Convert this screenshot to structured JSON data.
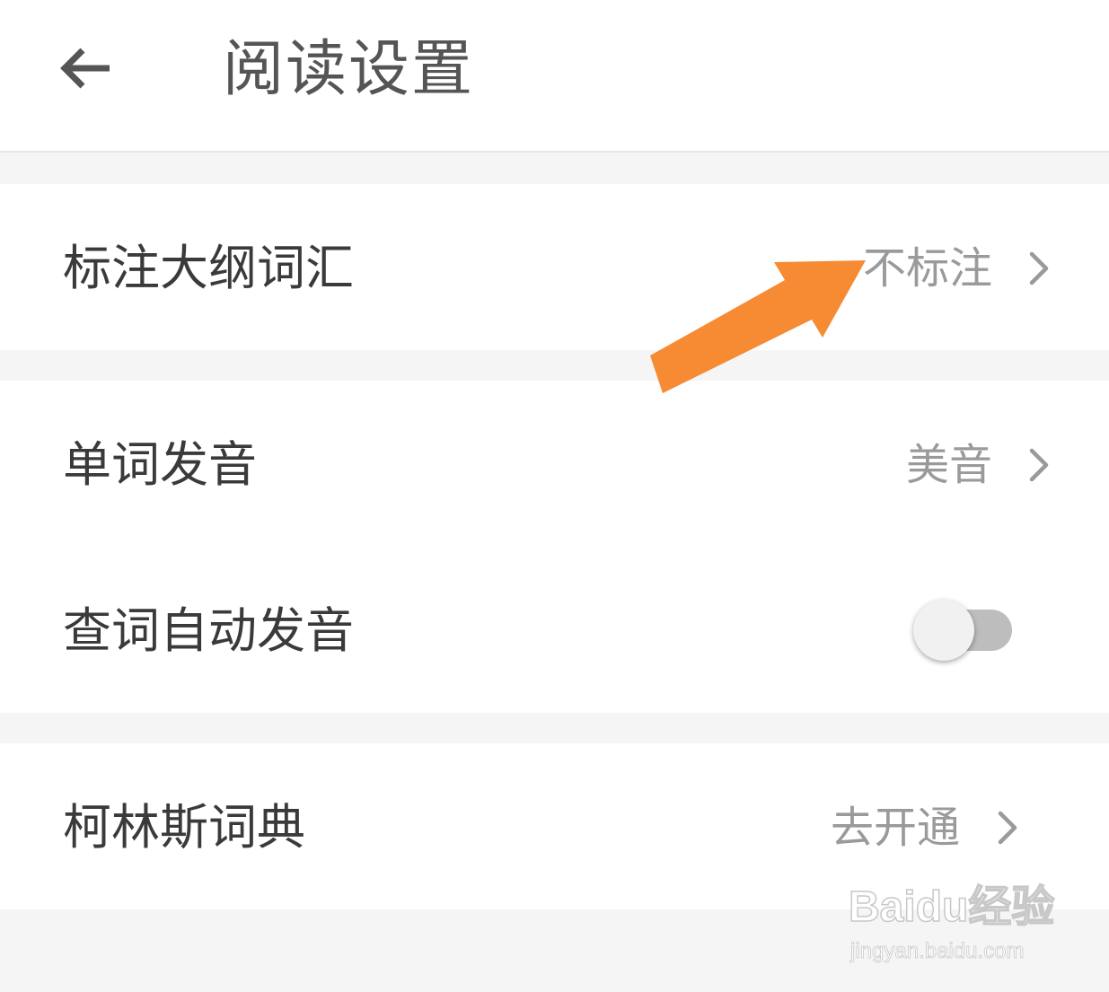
{
  "header": {
    "title": "阅读设置",
    "back_icon": "arrow-left-icon"
  },
  "settings": {
    "outline_words": {
      "label": "标注大纲词汇",
      "value": "不标注"
    },
    "pronunciation": {
      "label": "单词发音",
      "value": "美音"
    },
    "auto_pronounce": {
      "label": "查词自动发音",
      "enabled": false
    },
    "collins": {
      "label": "柯林斯词典",
      "value": "去开通"
    }
  },
  "annotation": {
    "icon": "orange-pointer-arrow",
    "color": "#f68b34"
  },
  "watermark": {
    "brand": "Baidu经验",
    "url": "jingyan.baidu.com"
  },
  "colors": {
    "background": "#f5f5f5",
    "surface": "#ffffff",
    "label_text": "#3a3a3a",
    "value_text": "#9a9a9a",
    "toggle_off_track": "#bdbdbd",
    "toggle_knob": "#f1f1f1"
  }
}
